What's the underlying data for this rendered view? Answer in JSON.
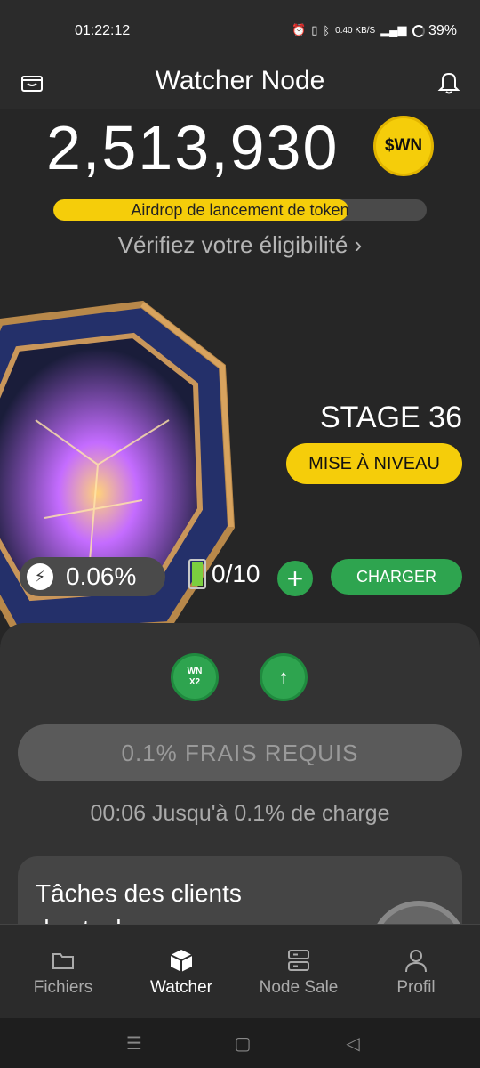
{
  "status": {
    "time": "01:22:12",
    "icons_text": "0.40 KB/S",
    "battery_percent": "39%"
  },
  "header": {
    "title": "Watcher Node"
  },
  "balance": {
    "amount": "2,513,930",
    "token": "$WN"
  },
  "airdrop": {
    "label": "Airdrop de lancement de token",
    "progress": 0.79
  },
  "eligibility": {
    "text": "Vérifiez votre éligibilité",
    "chevron": "›"
  },
  "stage": {
    "label": "STAGE 36",
    "upgrade_label": "MISE À NIVEAU"
  },
  "stats": {
    "rate": "0.06%",
    "batteries": "0/10",
    "charge_label": "CHARGER"
  },
  "boosts": {
    "wn_line1": "WN",
    "wn_line2": "X2"
  },
  "fee": {
    "label": "0.1% FRAIS REQUIS",
    "countdown": "00:06 Jusqu'à 0.1% de charge"
  },
  "tasks": {
    "title": "Tâches des clients des tech"
  },
  "tabs": [
    {
      "label": "Fichiers",
      "icon": "folder-icon",
      "active": false
    },
    {
      "label": "Watcher",
      "icon": "cube-icon",
      "active": true
    },
    {
      "label": "Node Sale",
      "icon": "server-icon",
      "active": false
    },
    {
      "label": "Profil",
      "icon": "user-icon",
      "active": false
    }
  ],
  "colors": {
    "accent_yellow": "#f5cd0a",
    "accent_green": "#2ea44f",
    "background": "#262626"
  }
}
